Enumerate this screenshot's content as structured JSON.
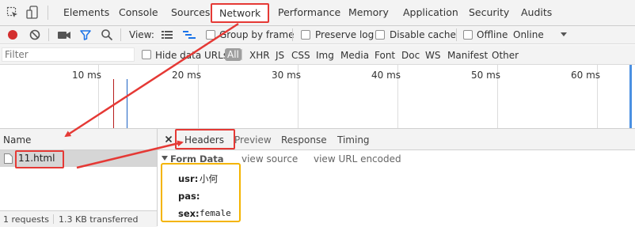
{
  "devtools": {
    "tabs": [
      "Elements",
      "Console",
      "Sources",
      "Network",
      "Performance",
      "Memory",
      "Application",
      "Security",
      "Audits"
    ],
    "selected_tab": "Network"
  },
  "toolbar": {
    "view_label": "View:",
    "group_by_frame": "Group by frame",
    "preserve_log": "Preserve log",
    "disable_cache": "Disable cache",
    "offline": "Offline",
    "throttle": "Online"
  },
  "filter": {
    "placeholder": "Filter",
    "hide_data_urls": "Hide data URLs",
    "types": [
      "All",
      "XHR",
      "JS",
      "CSS",
      "Img",
      "Media",
      "Font",
      "Doc",
      "WS",
      "Manifest",
      "Other"
    ]
  },
  "timeline": {
    "ticks": [
      "10 ms",
      "20 ms",
      "30 ms",
      "40 ms",
      "50 ms",
      "60 ms"
    ]
  },
  "requests": {
    "column_name": "Name",
    "items": [
      "11.html"
    ]
  },
  "details": {
    "tabs": [
      "Headers",
      "Preview",
      "Response",
      "Timing"
    ],
    "selected_tab": "Headers",
    "section_title": "Form Data",
    "view_source": "view source",
    "view_url_encoded": "view URL encoded",
    "form_data": [
      {
        "key": "usr:",
        "value": "小何"
      },
      {
        "key": "pas:",
        "value": ""
      },
      {
        "key": "sex:",
        "value": "female"
      }
    ]
  },
  "status": {
    "requests": "1 requests",
    "transferred": "1.3 KB transferred"
  },
  "colors": {
    "annotation_red": "#e53935",
    "annotation_yellow": "#f4b400",
    "record_red": "#d32f2f",
    "filter_blue": "#1a73e8"
  }
}
